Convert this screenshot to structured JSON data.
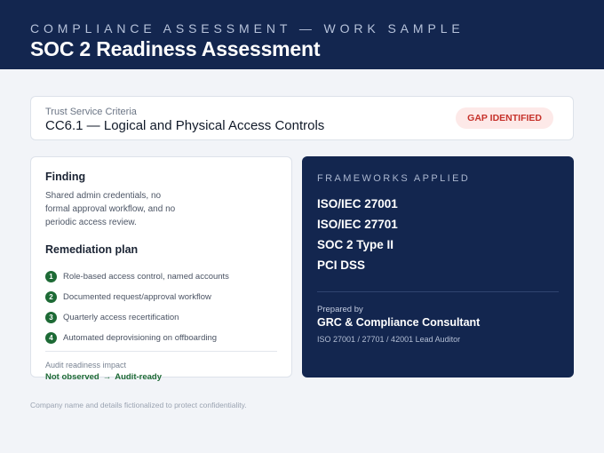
{
  "header": {
    "eyebrow": "COMPLIANCE ASSESSMENT — WORK SAMPLE",
    "title": "SOC 2 Readiness Assessment"
  },
  "criteria": {
    "label": "Trust Service Criteria",
    "title": "CC6.1 — Logical and Physical Access Controls",
    "status": "GAP IDENTIFIED",
    "status_color": "#c6322b"
  },
  "finding": {
    "heading": "Finding",
    "text": "Shared admin credentials, no formal approval workflow, and no periodic access review."
  },
  "remediation": {
    "heading": "Remediation plan",
    "steps": [
      {
        "num": "1",
        "text": "Role-based access control, named accounts"
      },
      {
        "num": "2",
        "text": "Documented request/approval workflow"
      },
      {
        "num": "3",
        "text": "Quarterly access recertification"
      },
      {
        "num": "4",
        "text": "Automated deprovisioning on offboarding"
      }
    ]
  },
  "impact": {
    "label": "Audit readiness impact",
    "from": "Not observed",
    "arrow": "→",
    "to": "Audit-ready",
    "color": "#1d6a35"
  },
  "frameworks": {
    "heading": "FRAMEWORKS APPLIED",
    "items": [
      "ISO/IEC 27001",
      "ISO/IEC 27701",
      "SOC 2 Type II",
      "PCI DSS"
    ]
  },
  "prepared": {
    "label": "Prepared by",
    "name": "GRC & Compliance Consultant",
    "credentials": "ISO 27001 / 27701 / 42001 Lead Auditor"
  },
  "footnote": "Company name and details fictionalized to protect confidentiality.",
  "colors": {
    "brand_navy": "#13264f",
    "success_green": "#1d6a35",
    "gap_red": "#c6322b"
  }
}
